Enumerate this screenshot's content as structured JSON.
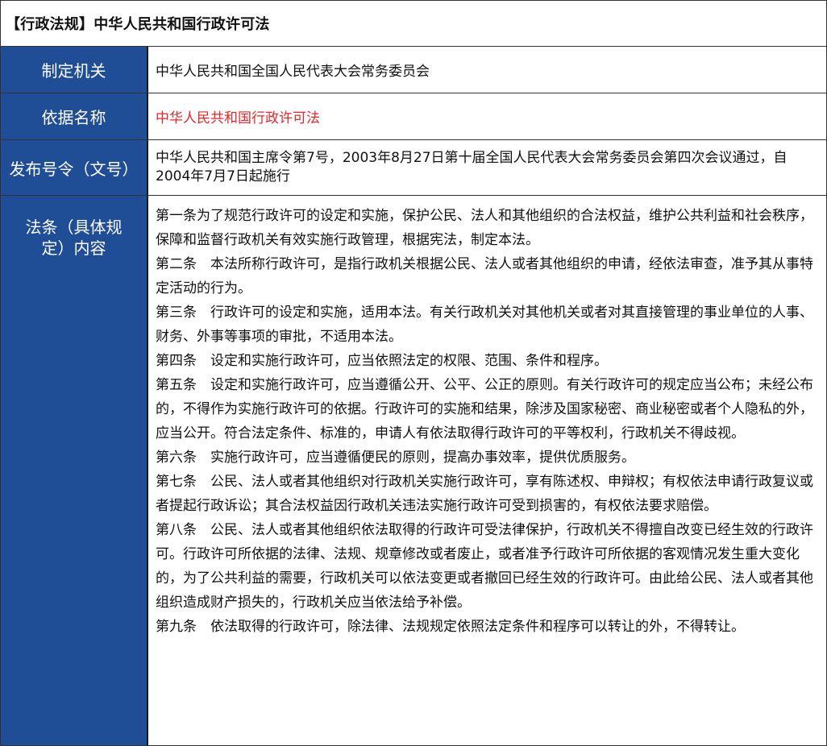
{
  "title": "【行政法规】中华人民共和国行政许可法",
  "rows": {
    "issuer": {
      "label": "制定机关",
      "value": "中华人民共和国全国人民代表大会常务委员会"
    },
    "basis": {
      "label": "依据名称",
      "value": "中华人民共和国行政许可法"
    },
    "decree": {
      "label": "发布号令（文号）",
      "value": "中华人民共和国主席令第7号，2003年8月27日第十届全国人民代表大会常务委员会第四次会议通过，自2004年7月7日起施行"
    },
    "content": {
      "label": "法条（具体规定）内容",
      "articles": [
        "第一条为了规范行政许可的设定和实施，保护公民、法人和其他组织的合法权益，维护公共利益和社会秩序，保障和监督行政机关有效实施行政管理，根据宪法，制定本法。",
        "第二条　本法所称行政许可，是指行政机关根据公民、法人或者其他组织的申请，经依法审查，准予其从事特定活动的行为。",
        "第三条　行政许可的设定和实施，适用本法。有关行政机关对其他机关或者对其直接管理的事业单位的人事、财务、外事等事项的审批，不适用本法。",
        "第四条　设定和实施行政许可，应当依照法定的权限、范围、条件和程序。",
        "第五条　设定和实施行政许可，应当遵循公开、公平、公正的原则。有关行政许可的规定应当公布；未经公布的，不得作为实施行政许可的依据。行政许可的实施和结果，除涉及国家秘密、商业秘密或者个人隐私的外，应当公开。符合法定条件、标准的，申请人有依法取得行政许可的平等权利，行政机关不得歧视。",
        "第六条　实施行政许可，应当遵循便民的原则，提高办事效率，提供优质服务。",
        "第七条　公民、法人或者其他组织对行政机关实施行政许可，享有陈述权、申辩权；有权依法申请行政复议或者提起行政诉讼；其合法权益因行政机关违法实施行政许可受到损害的，有权依法要求赔偿。",
        "第八条　公民、法人或者其他组织依法取得的行政许可受法律保护，行政机关不得擅自改变已经生效的行政许可。行政许可所依据的法律、法规、规章修改或者废止，或者准予行政许可所依据的客观情况发生重大变化的，为了公共利益的需要，行政机关可以依法变更或者撤回已经生效的行政许可。由此给公民、法人或者其他组织造成财产损失的，行政机关应当依法给予补偿。",
        "第九条　依法取得的行政许可，除法律、法规规定依照法定条件和程序可以转让的外，不得转让。"
      ]
    }
  },
  "colors": {
    "label_bg": "#1f4e96",
    "label_text": "#ffffff",
    "link_red": "#e8262b",
    "border": "#333333"
  }
}
